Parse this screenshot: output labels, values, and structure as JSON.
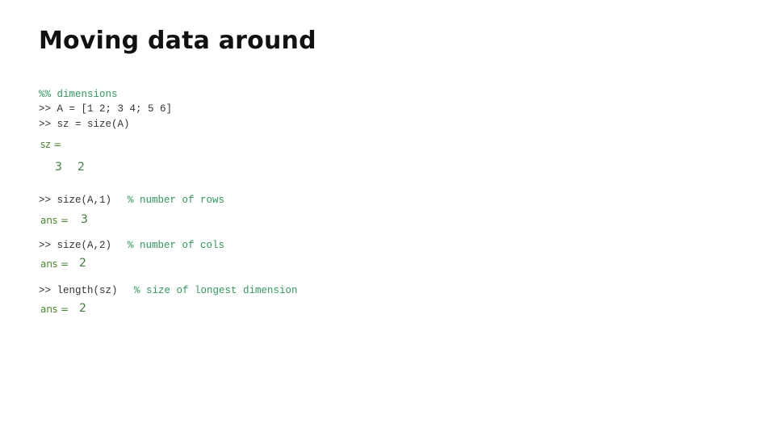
{
  "title": "Moving data around",
  "console": {
    "header_comment": "%% dimensions",
    "cmd1": ">> A = [1 2; 3 4; 5 6]",
    "cmd2": ">> sz = size(A)",
    "sz_label": "sz =",
    "sz_values": [
      "3",
      "2"
    ],
    "cmd3": ">> size(A,1)",
    "cmd3_comment": "% number of rows",
    "ans_label": "ans =",
    "ans3": "3",
    "cmd4": ">> size(A,2)",
    "cmd4_comment": "% number of cols",
    "ans4": "2",
    "cmd5": ">> length(sz)",
    "cmd5_comment": "% size of longest dimension",
    "ans5": "2"
  },
  "colors": {
    "comment": "#2e9a5a",
    "output": "#4a8a2a",
    "code": "#333333"
  }
}
